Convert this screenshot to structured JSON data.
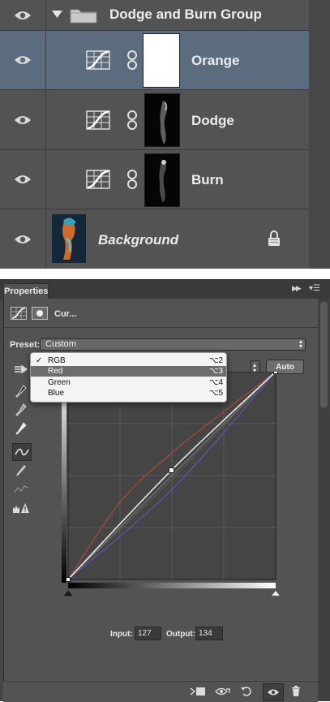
{
  "layers": {
    "group_name": "Dodge and Burn Group",
    "items": [
      {
        "name": "Orange",
        "selected": true
      },
      {
        "name": "Dodge",
        "selected": false
      },
      {
        "name": "Burn",
        "selected": false
      },
      {
        "name": "Background",
        "italic": true,
        "locked": true
      }
    ]
  },
  "properties": {
    "tab_label": "Properties",
    "header_title": "Cur...",
    "preset_label": "Preset:",
    "preset_value": "Custom",
    "auto_label": "Auto",
    "channel_menu": [
      {
        "label": "RGB",
        "shortcut": "⌥2",
        "checked": true
      },
      {
        "label": "Red",
        "shortcut": "⌥3",
        "highlighted": true
      },
      {
        "label": "Green",
        "shortcut": "⌥4"
      },
      {
        "label": "Blue",
        "shortcut": "⌥5"
      }
    ],
    "checkmark": "✓",
    "input_label": "Input:",
    "input_value": "127",
    "output_label": "Output:",
    "output_value": "134",
    "curves": {
      "rgb": [
        [
          0,
          0
        ],
        [
          127,
          134
        ],
        [
          255,
          255
        ]
      ],
      "red": [
        [
          0,
          0
        ],
        [
          64,
          95
        ],
        [
          127,
          155
        ],
        [
          190,
          205
        ],
        [
          255,
          255
        ]
      ],
      "green": [
        [
          0,
          0
        ],
        [
          127,
          123
        ],
        [
          255,
          255
        ]
      ],
      "blue": [
        [
          0,
          0
        ],
        [
          127,
          110
        ],
        [
          255,
          255
        ]
      ]
    },
    "colors": {
      "red_curve": "#a84a3c",
      "blue_curve": "#5a55b4",
      "rgb_curve": "#f2f2f2",
      "green_curve": "#595959"
    }
  }
}
